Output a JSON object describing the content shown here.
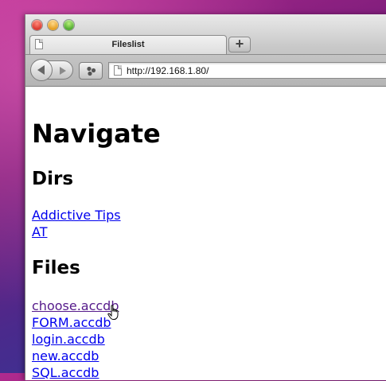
{
  "window": {
    "tab_title": "Fileslist",
    "new_tab_label": "+"
  },
  "toolbar": {
    "url": "http://192.168.1.80/"
  },
  "page": {
    "heading": "Navigate",
    "dirs": {
      "title": "Dirs",
      "items": [
        "Addictive Tips",
        "AT"
      ]
    },
    "files": {
      "title": "Files",
      "items": [
        "choose.accdb",
        "FORM.accdb",
        "login.accdb",
        "new.accdb",
        "SQL.accdb"
      ]
    }
  },
  "colors": {
    "link": "#0000ee",
    "visited_link": "#551a8b"
  },
  "icons": {
    "tab": "page-icon",
    "back": "back-arrow-icon",
    "forward": "forward-arrow-icon",
    "share": "share-icon",
    "address": "page-icon",
    "cursor": "hand-pointer-icon"
  }
}
